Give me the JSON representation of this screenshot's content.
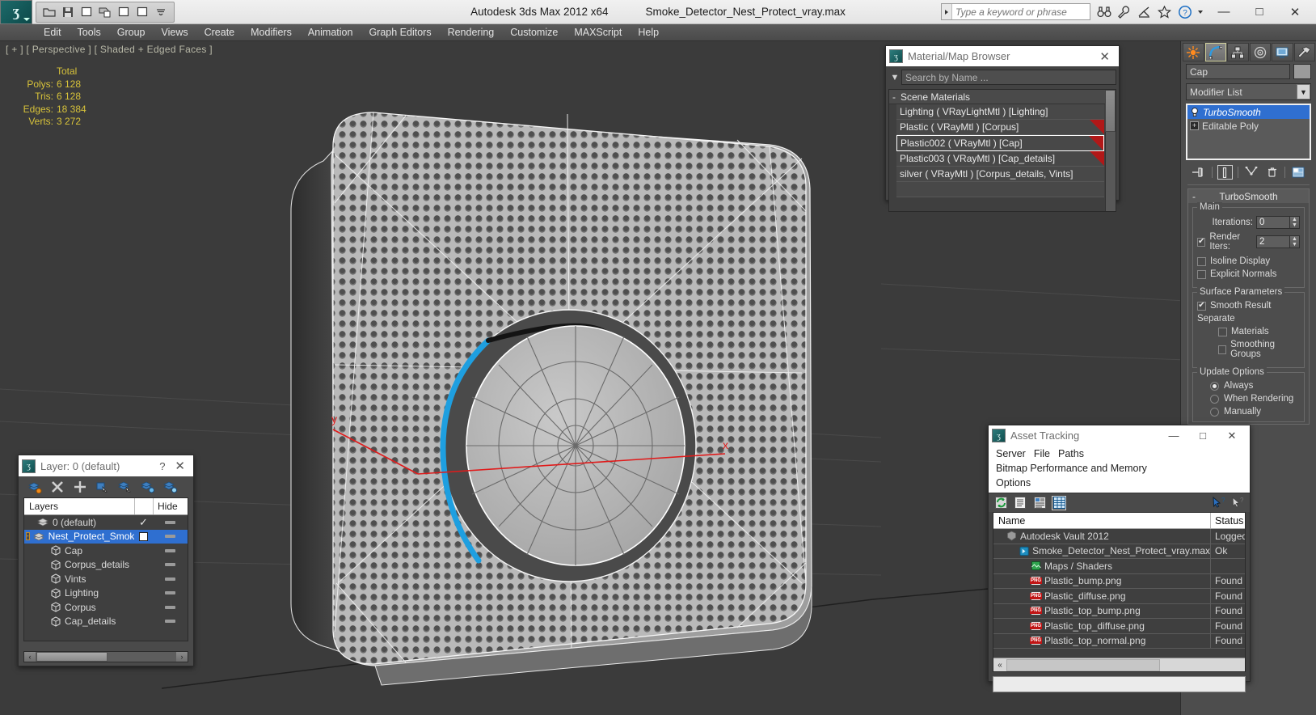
{
  "titlebar": {
    "app_name": "Autodesk 3ds Max  2012 x64",
    "file_name": "Smoke_Detector_Nest_Protect_vray.max",
    "search_placeholder": "Type a keyword or phrase",
    "quick_access": [
      {
        "name": "open-icon",
        "label": "Open"
      },
      {
        "name": "save-icon",
        "label": "Save"
      },
      {
        "name": "undo-icon",
        "label": "Undo"
      },
      {
        "name": "redo-icon",
        "label": "Redo"
      },
      {
        "name": "new-icon",
        "label": "New"
      },
      {
        "name": "set-icon",
        "label": "Set"
      }
    ],
    "window_buttons": {
      "minimize": "—",
      "maximize": "□",
      "close": "✕"
    }
  },
  "menubar": {
    "items": [
      "Edit",
      "Tools",
      "Group",
      "Views",
      "Create",
      "Modifiers",
      "Animation",
      "Graph Editors",
      "Rendering",
      "Customize",
      "MAXScript",
      "Help"
    ]
  },
  "viewport": {
    "label": "[ + ] [ Perspective ] [ Shaded + Edged Faces ]",
    "stats": {
      "header": "Total",
      "rows": [
        {
          "label": "Polys:",
          "value": "6 128"
        },
        {
          "label": "Tris:",
          "value": "6 128"
        },
        {
          "label": "Edges:",
          "value": "18 384"
        },
        {
          "label": "Verts:",
          "value": "3 272"
        }
      ]
    },
    "gizmo": {
      "x_label": "x",
      "y_label": "y"
    }
  },
  "material_browser": {
    "title": "Material/Map Browser",
    "close_label": "✕",
    "search_placeholder": "Search by Name ...",
    "section_title": "Scene Materials",
    "section_minus": "-",
    "items": [
      {
        "label": "Lighting  ( VRayLightMtl )  [Lighting]",
        "selected": false,
        "corner": false
      },
      {
        "label": "Plastic  ( VRayMtl )  [Corpus]",
        "selected": false,
        "corner": true
      },
      {
        "label": "Plastic002  ( VRayMtl )  [Cap]",
        "selected": true,
        "corner": true
      },
      {
        "label": "Plastic003  ( VRayMtl )  [Cap_details]",
        "selected": false,
        "corner": true
      },
      {
        "label": "silver ( VRayMtl ) [Corpus_details, Vints]",
        "selected": false,
        "corner": false
      }
    ]
  },
  "command_panel": {
    "tabs": [
      {
        "name": "create-tab",
        "selected": false
      },
      {
        "name": "modify-tab",
        "selected": true
      },
      {
        "name": "hierarchy-tab",
        "selected": false
      },
      {
        "name": "motion-tab",
        "selected": false
      },
      {
        "name": "display-tab",
        "selected": false
      },
      {
        "name": "utilities-tab",
        "selected": false
      }
    ],
    "object_name": "Cap",
    "modifier_list_label": "Modifier List",
    "modifier_stack": [
      {
        "label": "TurboSmooth",
        "selected": true
      },
      {
        "label": "Editable Poly",
        "selected": false
      }
    ],
    "rollout": {
      "title": "TurboSmooth",
      "collapse_sign": "-",
      "main_group": {
        "title": "Main",
        "iterations_label": "Iterations:",
        "iterations_value": "0",
        "render_iters_label": "Render Iters:",
        "render_iters_value": "2",
        "render_iters_checked": true,
        "isoline_label": "Isoline Display",
        "isoline_checked": false,
        "explicit_normals_label": "Explicit Normals",
        "explicit_normals_checked": false
      },
      "surface_group": {
        "title": "Surface Parameters",
        "smooth_result_label": "Smooth Result",
        "smooth_result_checked": true,
        "separate_label": "Separate",
        "materials_label": "Materials",
        "materials_checked": false,
        "smoothing_groups_label": "Smoothing Groups",
        "smoothing_groups_checked": false
      },
      "update_group": {
        "title": "Update Options",
        "options": [
          {
            "label": "Always",
            "selected": true
          },
          {
            "label": "When Rendering",
            "selected": false
          },
          {
            "label": "Manually",
            "selected": false
          }
        ]
      }
    }
  },
  "layer_panel": {
    "title": "Layer: 0 (default)",
    "help_label": "?",
    "close_label": "✕",
    "tools": [
      {
        "name": "create-new-layer-icon"
      },
      {
        "name": "delete-layer-icon"
      },
      {
        "name": "add-selection-icon"
      },
      {
        "name": "select-objects-icon"
      },
      {
        "name": "select-highlighted-icon"
      },
      {
        "name": "highlight-selected-icon"
      },
      {
        "name": "layer-properties-icon"
      }
    ],
    "columns": {
      "name": "Layers",
      "hide": "Hide"
    },
    "rows": [
      {
        "label": "0 (default)",
        "type": "layer",
        "indent": 1,
        "selected": false,
        "check": "✓",
        "hide": true,
        "expander": null
      },
      {
        "label": "Nest_Protect_Smoke",
        "type": "layer",
        "indent": 0,
        "selected": true,
        "check": "box",
        "hide": true,
        "expander": "-"
      },
      {
        "label": "Cap",
        "type": "object",
        "indent": 2,
        "selected": false,
        "check": "",
        "hide": true,
        "expander": null
      },
      {
        "label": "Corpus_details",
        "type": "object",
        "indent": 2,
        "selected": false,
        "check": "",
        "hide": true,
        "expander": null
      },
      {
        "label": "Vints",
        "type": "object",
        "indent": 2,
        "selected": false,
        "check": "",
        "hide": true,
        "expander": null
      },
      {
        "label": "Lighting",
        "type": "object",
        "indent": 2,
        "selected": false,
        "check": "",
        "hide": true,
        "expander": null
      },
      {
        "label": "Corpus",
        "type": "object",
        "indent": 2,
        "selected": false,
        "check": "",
        "hide": true,
        "expander": null
      },
      {
        "label": "Cap_details",
        "type": "object",
        "indent": 2,
        "selected": false,
        "check": "",
        "hide": true,
        "expander": null
      }
    ],
    "scroll_left_arrow": "‹",
    "scroll_right_arrow": "›"
  },
  "asset_tracking": {
    "title": "Asset Tracking",
    "window_buttons": {
      "minimize": "—",
      "maximize": "□",
      "close": "✕"
    },
    "menu": [
      "Server",
      "File",
      "Paths",
      "Bitmap Performance and Memory",
      "Options"
    ],
    "toolbar": [
      {
        "name": "refresh-icon",
        "selected": false
      },
      {
        "name": "list-view-icon",
        "selected": false
      },
      {
        "name": "detail-view-icon",
        "selected": false
      },
      {
        "name": "table-view-icon",
        "selected": true
      }
    ],
    "toolbar_right": [
      {
        "name": "help-cursor-icon"
      },
      {
        "name": "pointer-question-icon"
      }
    ],
    "columns": {
      "name": "Name",
      "status": "Status"
    },
    "rows": [
      {
        "name": "Autodesk Vault 2012",
        "status": "Logged O",
        "indent": 1,
        "icon": "vault-icon"
      },
      {
        "name": "Smoke_Detector_Nest_Protect_vray.max",
        "status": "Ok",
        "indent": 2,
        "icon": "max-file-icon"
      },
      {
        "name": "Maps / Shaders",
        "status": "",
        "indent": 3,
        "icon": "maps-icon"
      },
      {
        "name": "Plastic_bump.png",
        "status": "Found",
        "indent": 3,
        "icon": "png-icon"
      },
      {
        "name": "Plastic_diffuse.png",
        "status": "Found",
        "indent": 3,
        "icon": "png-icon"
      },
      {
        "name": "Plastic_top_bump.png",
        "status": "Found",
        "indent": 3,
        "icon": "png-icon"
      },
      {
        "name": "Plastic_top_diffuse.png",
        "status": "Found",
        "indent": 3,
        "icon": "png-icon"
      },
      {
        "name": "Plastic_top_normal.png",
        "status": "Found",
        "indent": 3,
        "icon": "png-icon"
      }
    ],
    "scroll_left_arrow": "«"
  },
  "colors": {
    "accent_blue": "#2f6fd0",
    "viewport_bg": "#3b3b3b",
    "stat_yellow": "#d7c23a",
    "highlight_edge": "#1e9fe0",
    "red_corner": "#b11818"
  }
}
